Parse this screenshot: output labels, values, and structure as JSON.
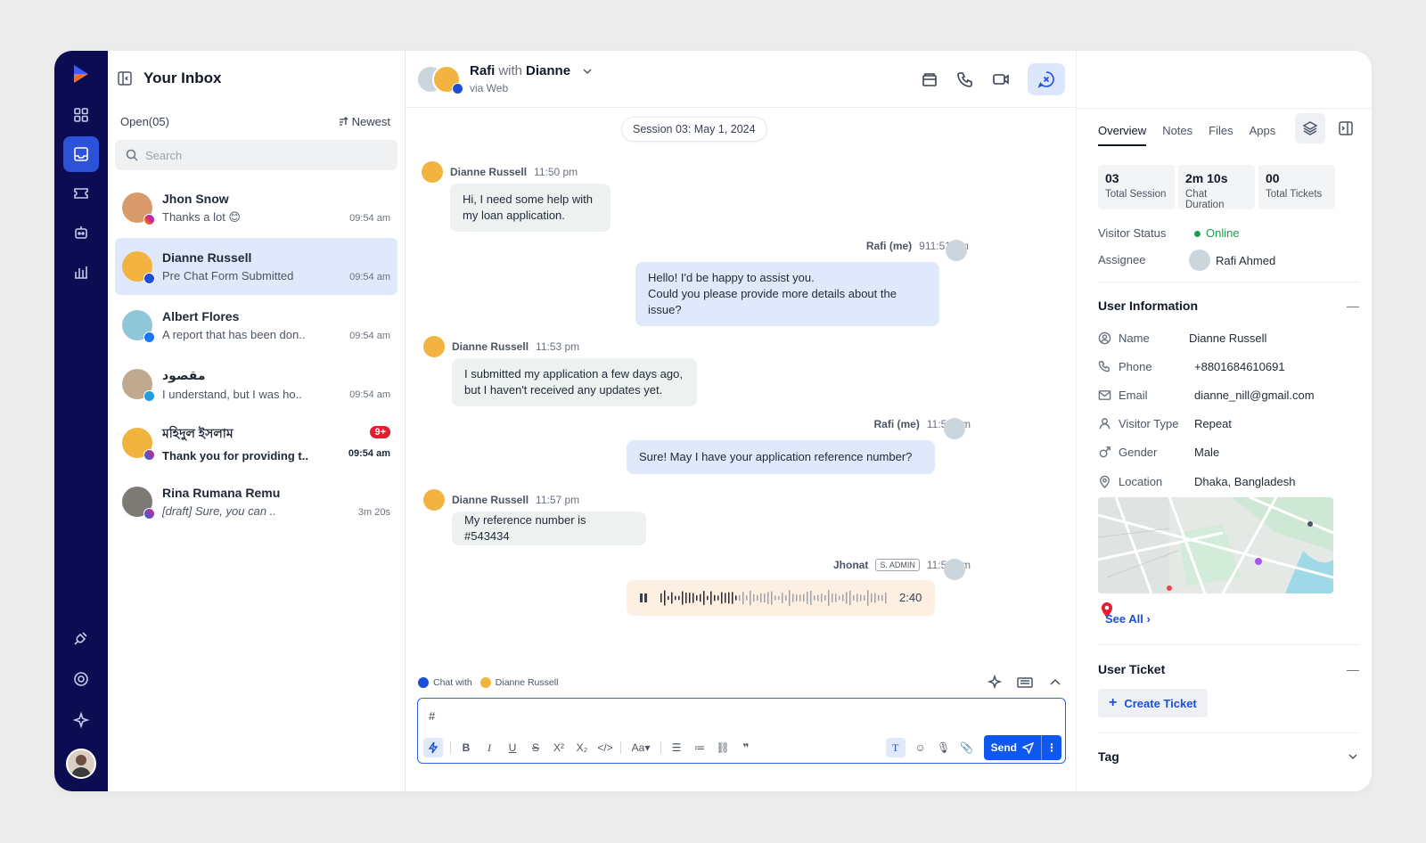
{
  "sidebar": {
    "nav": [
      "grid-icon",
      "inbox-icon",
      "ticket-icon",
      "bot-icon",
      "chart-icon"
    ],
    "bottom": [
      "plug-icon",
      "settings-icon",
      "sparkle-icon"
    ]
  },
  "inbox": {
    "title": "Your Inbox",
    "filter": "Open(05)",
    "sort": "Newest",
    "search_placeholder": "Search",
    "conversations": [
      {
        "name": "Jhon Snow",
        "preview": "Thanks a lot 😊",
        "time": "09:54 am",
        "channel": "instagram",
        "color": "#d99a6c"
      },
      {
        "name": "Dianne Russell",
        "preview": "Pre Chat Form Submitted",
        "time": "09:54 am",
        "channel": "web",
        "color": "#f3b340"
      },
      {
        "name": "Albert Flores",
        "preview": "A report that has been don..",
        "time": "09:54 am",
        "channel": "facebook",
        "color": "#8fc7d9"
      },
      {
        "name": "مقصود",
        "preview": "I understand, but I was ho..",
        "time": "09:54 am",
        "channel": "telegram",
        "color": "#bfa98f"
      },
      {
        "name": "মহিদুল ইসলাম",
        "preview": "Thank you for providing t..",
        "time": "09:54 am",
        "channel": "messenger",
        "color": "#f0b33e",
        "unread": "9+"
      },
      {
        "name": "Rina Rumana Remu",
        "preview": "[draft] Sure, you can ..",
        "time": "3m 20s",
        "channel": "messenger",
        "color": "#7d7a76"
      }
    ]
  },
  "chat": {
    "agent": "Rafi",
    "with_word": "with",
    "customer": "Dianne",
    "via": "via Web",
    "session": "Session 03: May 1, 2024",
    "messages": [
      {
        "sender": "Dianne Russell",
        "time": "11:50 pm",
        "lines": [
          "Hi, I need some help with",
          "my loan application."
        ]
      },
      {
        "sender": "Rafi (me)",
        "time": "911:51 pm",
        "lines": [
          "Hello! I'd be happy to assist you.",
          "Could you please provide more details about the issue?"
        ]
      },
      {
        "sender": "Dianne Russell",
        "time": "11:53 pm",
        "lines": [
          "I submitted my application a few days ago,",
          "but I haven't received any updates yet."
        ]
      },
      {
        "sender": "Rafi (me)",
        "time": "11:54 pm",
        "lines": [
          "Sure! May I have your application reference number?"
        ]
      },
      {
        "sender": "Dianne Russell",
        "time": "11:57 pm",
        "lines": [
          "My reference number is #543434"
        ]
      },
      {
        "sender": "Jhonat",
        "role": "S. ADMIN",
        "time": "11:58 pm",
        "audio_duration": "2:40"
      }
    ],
    "composer": {
      "chat_with_label": "Chat with",
      "chat_with_name": "Dianne Russell",
      "value": "#",
      "send": "Send"
    }
  },
  "details": {
    "tabs": [
      "Overview",
      "Notes",
      "Files",
      "Apps"
    ],
    "stats": [
      {
        "value": "03",
        "label": "Total Session"
      },
      {
        "value": "2m 10s",
        "label": "Chat Duration"
      },
      {
        "value": "00",
        "label": "Total Tickets"
      }
    ],
    "visitor_status_label": "Visitor Status",
    "visitor_status": "Online",
    "assignee_label": "Assignee",
    "assignee": "Rafi Ahmed",
    "user_info_title": "User Information",
    "fields": [
      {
        "label": "Name",
        "value": "Dianne Russell",
        "icon": "user-circle-icon"
      },
      {
        "label": "Phone",
        "value": "+8801684610691",
        "icon": "phone-icon"
      },
      {
        "label": "Email",
        "value": "dianne_nill@gmail.com",
        "icon": "mail-icon"
      },
      {
        "label": "Visitor Type",
        "value": "Repeat",
        "icon": "person-icon"
      },
      {
        "label": "Gender",
        "value": "Male",
        "icon": "gender-icon"
      },
      {
        "label": "Location",
        "value": "Dhaka, Bangladesh",
        "icon": "location-pin-icon"
      }
    ],
    "see_all": "See All",
    "ticket_title": "User Ticket",
    "create_ticket": "Create Ticket",
    "tag_title": "Tag"
  },
  "colors": {
    "rail": "#0b0c52",
    "accent": "#0e58f0",
    "active_row": "#dfe9fb",
    "online": "#16a34a"
  }
}
